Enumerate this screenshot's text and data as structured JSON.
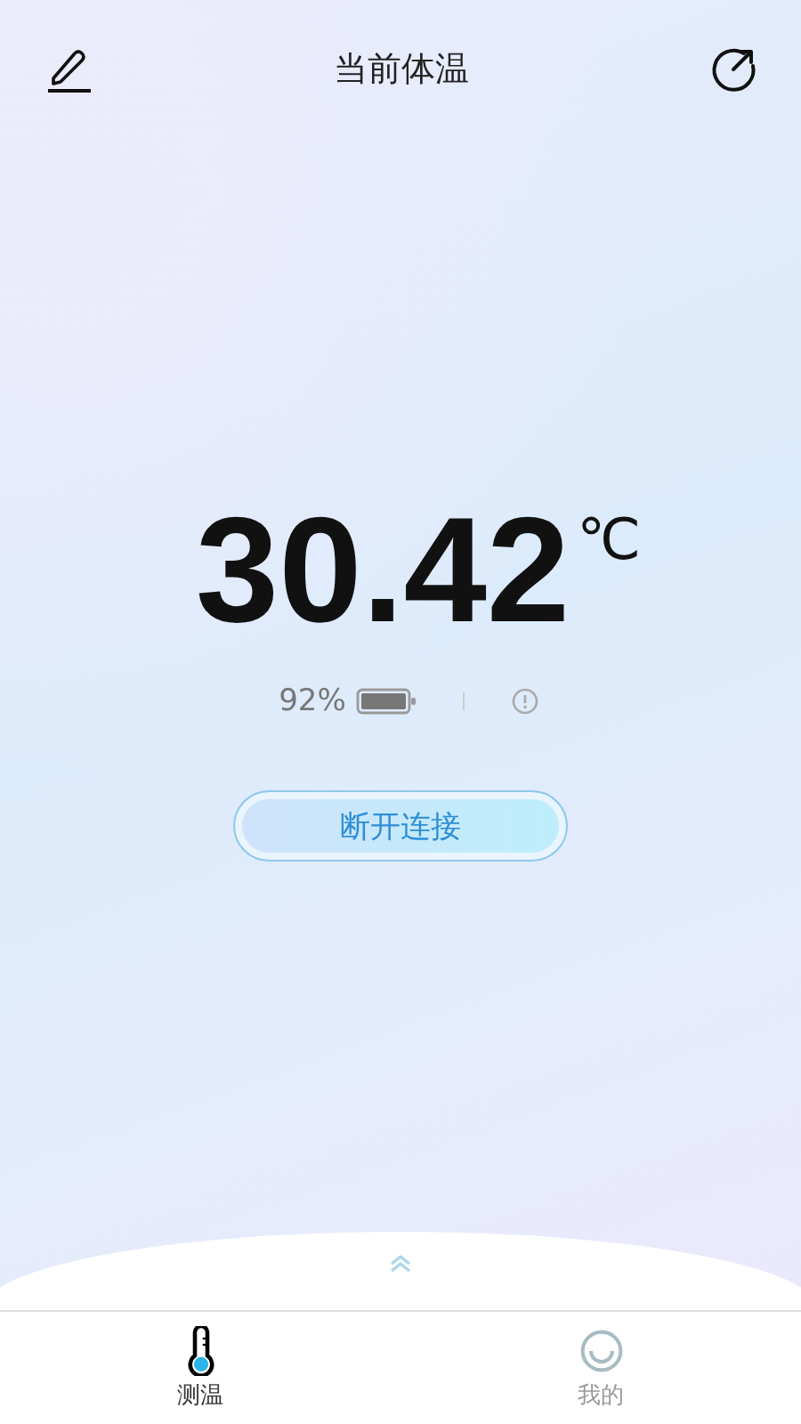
{
  "header": {
    "title": "当前体温"
  },
  "reading": {
    "value": "30.42",
    "unit": "℃"
  },
  "status": {
    "battery": "92%"
  },
  "action": {
    "label": "断开连接"
  },
  "tabs": [
    {
      "label": "测温",
      "kind": "thermometer",
      "selected": true
    },
    {
      "label": "我的",
      "kind": "face",
      "selected": false
    }
  ]
}
